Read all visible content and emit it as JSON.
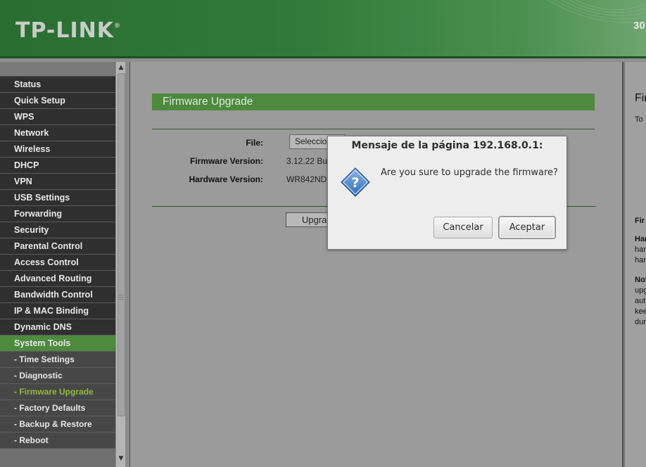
{
  "header": {
    "logo": "TP-LINK",
    "logo_mark": "®",
    "model_partial": "30"
  },
  "sidebar": {
    "items": [
      {
        "label": "Status"
      },
      {
        "label": "Quick Setup"
      },
      {
        "label": "WPS"
      },
      {
        "label": "Network"
      },
      {
        "label": "Wireless"
      },
      {
        "label": "DHCP"
      },
      {
        "label": "VPN"
      },
      {
        "label": "USB Settings"
      },
      {
        "label": "Forwarding"
      },
      {
        "label": "Security"
      },
      {
        "label": "Parental Control"
      },
      {
        "label": "Access Control"
      },
      {
        "label": "Advanced Routing"
      },
      {
        "label": "Bandwidth Control"
      },
      {
        "label": "IP & MAC Binding"
      },
      {
        "label": "Dynamic DNS"
      },
      {
        "label": "System Tools"
      },
      {
        "label": "- Time Settings"
      },
      {
        "label": "- Diagnostic"
      },
      {
        "label": "- Firmware Upgrade"
      },
      {
        "label": "- Factory Defaults"
      },
      {
        "label": "- Backup & Restore"
      },
      {
        "label": "- Reboot"
      }
    ]
  },
  "main": {
    "section_title": "Firmware Upgrade",
    "file_label": "File:",
    "file_button": "Seleccionar archivo",
    "firmware_label": "Firmware Version:",
    "firmware_value": "3.12.22 Build 120424 Rel.36748n",
    "hardware_label": "Hardware Version:",
    "hardware_value": "WR842ND v1 00000000",
    "upgrade_button": "Upgrade"
  },
  "help": {
    "title_partial": "Fir",
    "line1": "To",
    "line2": "Fir",
    "line3": "Har",
    "line4": "har",
    "line5": "har",
    "line6": "Not",
    "line7": "upg",
    "line8": "aut",
    "line9": "kee",
    "line10": "dur"
  },
  "dialog": {
    "title": "Mensaje de la página 192.168.0.1:",
    "message": "Are you sure to upgrade the firmware?",
    "icon": "question-icon",
    "cancel_label": "Cancelar",
    "accept_label": "Aceptar"
  },
  "colors": {
    "brand_green": "#4d8a3e",
    "menu_dark": "#2f2f2f",
    "menu_sub": "#474747",
    "current_item": "#8fbc3a"
  }
}
